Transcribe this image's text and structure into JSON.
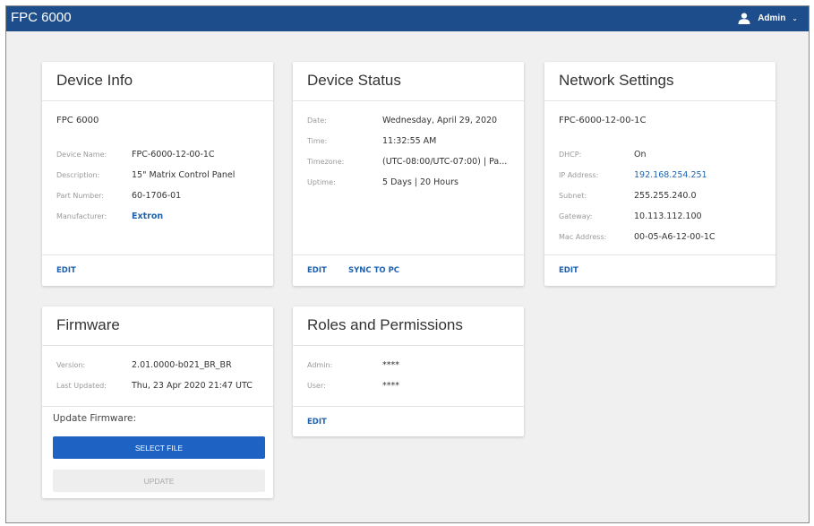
{
  "app": {
    "title": "FPC 6000",
    "user": "Admin"
  },
  "device_info": {
    "title": "Device Info",
    "subtitle": "FPC 6000",
    "rows": [
      {
        "label": "Device Name:",
        "value": "FPC-6000-12-00-1C"
      },
      {
        "label": "Description:",
        "value": "15\" Matrix Control Panel"
      },
      {
        "label": "Part Number:",
        "value": "60-1706-01"
      },
      {
        "label": "Manufacturer:",
        "value": "Extron"
      }
    ],
    "edit_label": "EDIT"
  },
  "device_status": {
    "title": "Device Status",
    "rows": [
      {
        "label": "Date:",
        "value": "Wednesday, April 29, 2020"
      },
      {
        "label": "Time:",
        "value": "11:32:55 AM"
      },
      {
        "label": "Timezone:",
        "value": "(UTC-08:00/UTC-07:00) | Pa..."
      },
      {
        "label": "Uptime:",
        "value": "5 Days | 20 Hours"
      }
    ],
    "edit_label": "EDIT",
    "sync_label": "SYNC TO PC"
  },
  "network_settings": {
    "title": "Network Settings",
    "subtitle": "FPC-6000-12-00-1C",
    "rows": [
      {
        "label": "DHCP:",
        "value": "On"
      },
      {
        "label": "IP Address:",
        "value": "192.168.254.251"
      },
      {
        "label": "Subnet:",
        "value": "255.255.240.0"
      },
      {
        "label": "Gateway:",
        "value": "10.113.112.100"
      },
      {
        "label": "Mac Address:",
        "value": "00-05-A6-12-00-1C"
      }
    ],
    "edit_label": "EDIT"
  },
  "firmware": {
    "title": "Firmware",
    "rows": [
      {
        "label": "Version:",
        "value": "2.01.0000-b021_BR_BR"
      },
      {
        "label": "Last Updated:",
        "value": "Thu, 23 Apr 2020 21:47 UTC"
      }
    ],
    "update_label": "Update Firmware:",
    "select_file_label": "SELECT FILE",
    "update_button_label": "UPDATE"
  },
  "roles": {
    "title": "Roles and Permissions",
    "rows": [
      {
        "label": "Admin:",
        "value": "****"
      },
      {
        "label": "User:",
        "value": "****"
      }
    ],
    "edit_label": "EDIT"
  },
  "colors": {
    "header": "#1e4d8c",
    "accent": "#1e62b0",
    "primary_button": "#1e62c4"
  }
}
